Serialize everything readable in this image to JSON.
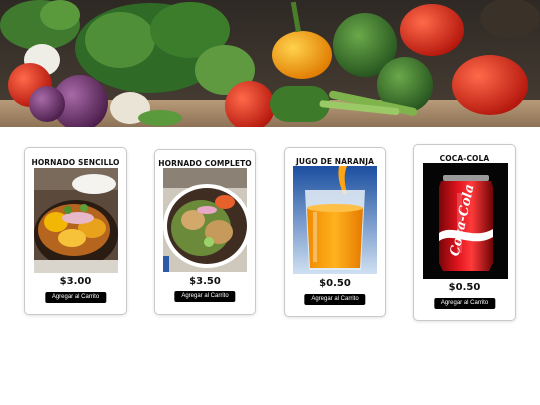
{
  "hero": {
    "image": "fresh vegetables banner (broccoli, tomatoes, peppers, onions, garlic)"
  },
  "products": [
    {
      "name": "HORNADO SENCILLO",
      "price": "$3.00",
      "button_label": "Agregar al Carrito"
    },
    {
      "name": "HORNADO COMPLETO",
      "price": "$3.50",
      "button_label": "Agregar al Carrito"
    },
    {
      "name": "JUGO DE NARANJA",
      "price": "$0.50",
      "button_label": "Agregar al Carrito"
    },
    {
      "name": "COCA-COLA",
      "price": "$0.50",
      "button_label": "Agregar al Carrito"
    }
  ],
  "coca_cola_logo_text": "Coca-Cola",
  "colors": {
    "button_bg": "#000000",
    "button_text": "#ffffff",
    "card_border": "#c9c9c9",
    "coke_red": "#d0121b"
  }
}
